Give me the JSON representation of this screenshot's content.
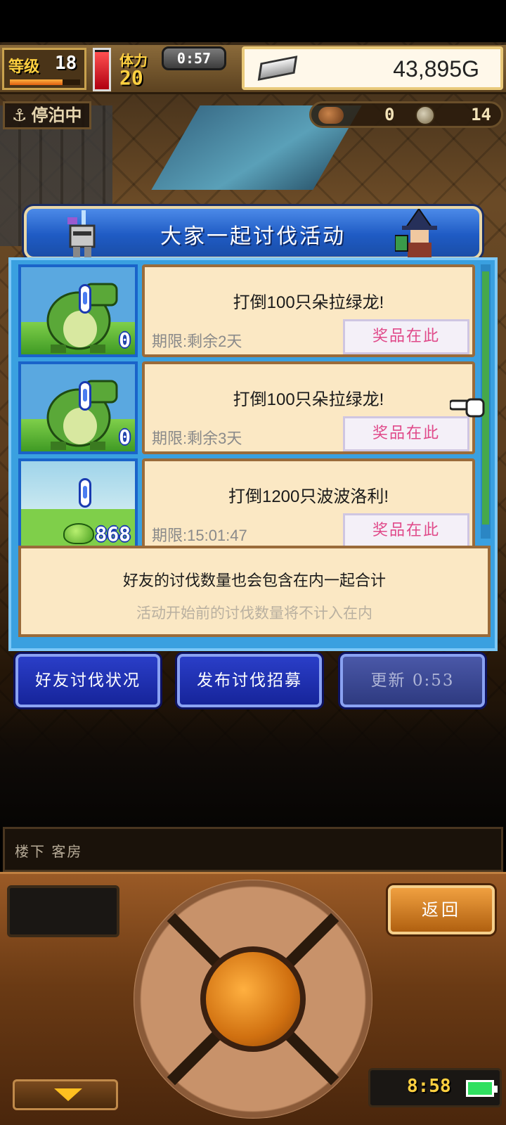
{
  "status": {
    "level_label": "等级",
    "level_value": "18",
    "level_progress": 0.75,
    "stamina_label": "体力",
    "stamina_value": "20",
    "stamina_fill": 0.95,
    "timer": "0:57",
    "gold": "43,895G",
    "anchor_status": "停泊中",
    "resource_count_1": "0",
    "resource_count_2": "14"
  },
  "dialog": {
    "title": "大家一起讨伐活动",
    "quests": [
      {
        "name": "打倒100只朵拉绿龙!",
        "deadline": "期限:剩余2天",
        "count": "0",
        "prize_label": "奖品在此",
        "monster_icon": "green-dragon-icon"
      },
      {
        "name": "打倒100只朵拉绿龙!",
        "deadline": "期限:剩余3天",
        "count": "0",
        "prize_label": "奖品在此",
        "monster_icon": "green-dragon-icon"
      },
      {
        "name": "打倒1200只波波洛利!",
        "deadline": "期限:15:01:47",
        "count": "868",
        "prize_label": "奖品在此",
        "monster_icon": "green-slime-icon"
      }
    ],
    "info_main": "好友的讨伐数量也会包含在内一起合计",
    "info_sub": "活动开始前的讨伐数量将不计入在内"
  },
  "buttons": {
    "friend_status": "好友讨伐状况",
    "post_recruit": "发布讨伐招募",
    "refresh": "更新 0:53"
  },
  "location": "楼下 客房",
  "controller": {
    "back_label": "返回",
    "clock": "8:58",
    "battery_level": 1.0
  },
  "colors": {
    "dialog_blue": "#3aa0e0",
    "card_cream": "#fbe8c4",
    "prize_pink": "#e04a8a",
    "button_blue": "#1f30b0",
    "gold_yellow": "#ffd040"
  }
}
